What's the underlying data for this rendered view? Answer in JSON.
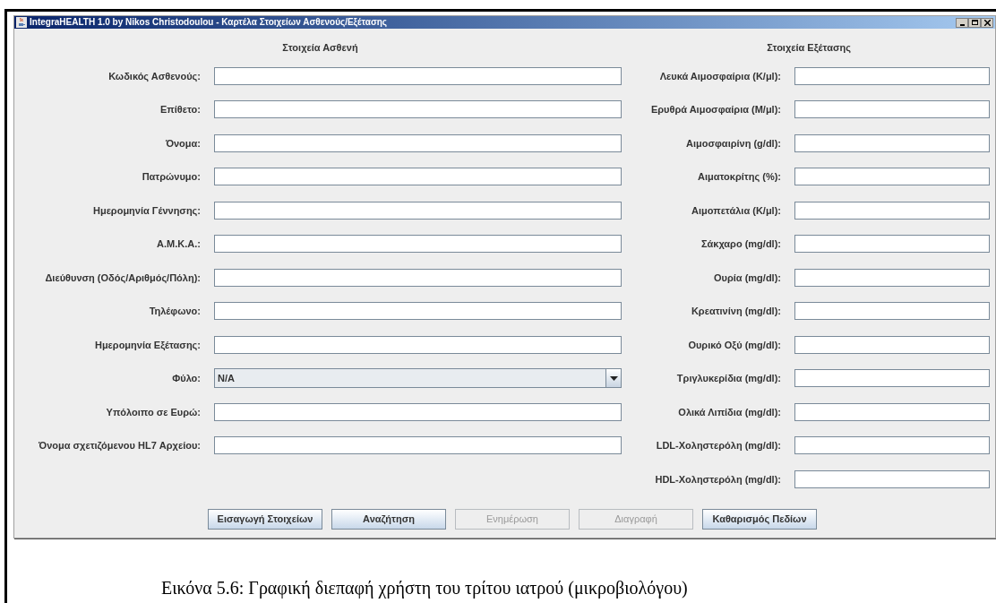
{
  "window": {
    "title": "IntegraHEALTH 1.0 by Nikos Christodoulou - Καρτέλα Στοιχείων Ασθενούς/Εξέτασης"
  },
  "patient_section": {
    "heading": "Στοιχεία Ασθενή",
    "fields": [
      {
        "kind": "text",
        "label": "Κωδικός Ασθενούς:"
      },
      {
        "kind": "text",
        "label": "Επίθετο:"
      },
      {
        "kind": "text",
        "label": "Όνομα:"
      },
      {
        "kind": "text",
        "label": "Πατρώνυμο:"
      },
      {
        "kind": "text",
        "label": "Ημερομηνία Γέννησης:"
      },
      {
        "kind": "text",
        "label": "Α.Μ.Κ.Α.:"
      },
      {
        "kind": "text",
        "label": "Διεύθυνση (Οδός/Αριθμός/Πόλη):"
      },
      {
        "kind": "text",
        "label": "Τηλέφωνο:"
      },
      {
        "kind": "text",
        "label": "Ημερομηνία Εξέτασης:"
      },
      {
        "kind": "select",
        "label": "Φύλο:",
        "value": "N/A"
      },
      {
        "kind": "text",
        "label": "Υπόλοιπο σε Ευρώ:"
      },
      {
        "kind": "text",
        "label": "Όνομα σχετιζόμενου HL7 Αρχείου:"
      }
    ]
  },
  "exam_section": {
    "heading": "Στοιχεία Εξέτασης",
    "fields": [
      {
        "label": "Λευκά Αιμοσφαίρια (K/μl):"
      },
      {
        "label": "Ερυθρά Αιμοσφαίρια (M/μl):"
      },
      {
        "label": "Αιμοσφαιρίνη (g/dl):"
      },
      {
        "label": "Αιματοκρίτης (%):"
      },
      {
        "label": "Αιμοπετάλια (K/μl):"
      },
      {
        "label": "Σάκχαρο (mg/dl):"
      },
      {
        "label": "Ουρία (mg/dl):"
      },
      {
        "label": "Κρεατινίνη (mg/dl):"
      },
      {
        "label": "Ουρικό Οξύ (mg/dl):"
      },
      {
        "label": "Τριγλυκερίδια (mg/dl):"
      },
      {
        "label": "Ολικά Λιπίδια (mg/dl):"
      },
      {
        "label": "LDL-Χοληστερόλη (mg/dl):"
      },
      {
        "label": "HDL-Χοληστερόλη (mg/dl):"
      }
    ]
  },
  "buttons": [
    {
      "label": "Εισαγωγή Στοιχείων",
      "disabled": false
    },
    {
      "label": "Αναζήτηση",
      "disabled": false
    },
    {
      "label": "Ενημέρωση",
      "disabled": true
    },
    {
      "label": "Διαγραφή",
      "disabled": true
    },
    {
      "label": "Καθαρισμός Πεδίων",
      "disabled": false
    }
  ],
  "caption": "Εικόνα 5.6: Γραφική διεπαφή χρήστη του τρίτου ιατρού (μικροβιολόγου)"
}
